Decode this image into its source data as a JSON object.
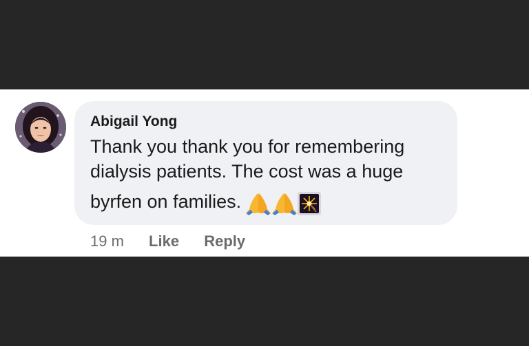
{
  "comment": {
    "author": "Abigail Yong",
    "text_line_1": "Thank you thank you for remembering",
    "text_line_2": "dialysis patients. The cost was a huge",
    "text_line_3": "byrfen on families.",
    "emojis": [
      "folded-hands",
      "folded-hands",
      "sparkler"
    ]
  },
  "actions": {
    "timestamp": "19 m",
    "like_label": "Like",
    "reply_label": "Reply"
  }
}
